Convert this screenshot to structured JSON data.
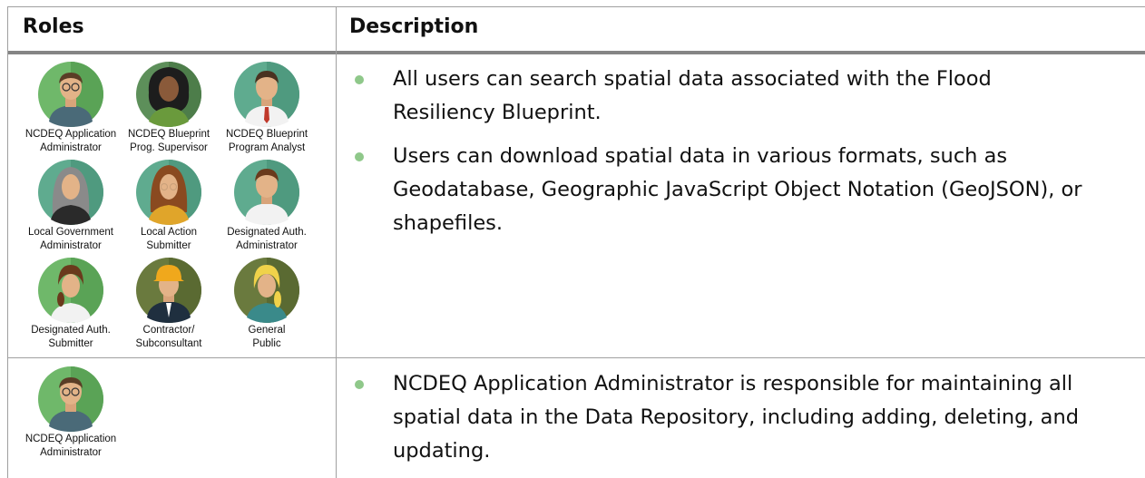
{
  "header": {
    "roles": "Roles",
    "description": "Description"
  },
  "rows": [
    {
      "roles": [
        {
          "line1": "NCDEQ Application",
          "line2": "Administrator",
          "avatar": "male-glasses-avatar"
        },
        {
          "line1": "NCDEQ Blueprint",
          "line2": "Prog. Supervisor",
          "avatar": "female-dark-hair-avatar"
        },
        {
          "line1": "NCDEQ Blueprint",
          "line2": "Program Analyst",
          "avatar": "male-tie-avatar"
        },
        {
          "line1": "Local Government",
          "line2": "Administrator",
          "avatar": "female-gray-hair-avatar"
        },
        {
          "line1": "Local Action",
          "line2": "Submitter",
          "avatar": "female-glasses-avatar"
        },
        {
          "line1": "Designated Auth.",
          "line2": "Administrator",
          "avatar": "male-avatar"
        },
        {
          "line1": "Designated Auth.",
          "line2": "Submitter",
          "avatar": "female-ponytail-avatar"
        },
        {
          "line1": "Contractor/",
          "line2": "Subconsultant",
          "avatar": "hardhat-worker-avatar"
        },
        {
          "line1": "General",
          "line2": "Public",
          "avatar": "female-blonde-avatar"
        }
      ],
      "bullets": [
        "All users can search spatial data associated with the Flood Resiliency Blueprint.",
        "Users can download spatial data in various formats, such as Geodatabase, Geographic JavaScript Object Notation (GeoJSON), or shapefiles."
      ]
    },
    {
      "roles": [
        {
          "line1": "NCDEQ Application",
          "line2": "Administrator",
          "avatar": "male-glasses-avatar"
        }
      ],
      "bullets": [
        "NCDEQ Application Administrator is responsible for maintaining all spatial data in the Data Repository, including adding, deleting, and updating."
      ]
    }
  ],
  "colors": {
    "bullet": "#8fc88a",
    "rule": "#a0a0a0",
    "header_rule": "#7f7f7f"
  }
}
